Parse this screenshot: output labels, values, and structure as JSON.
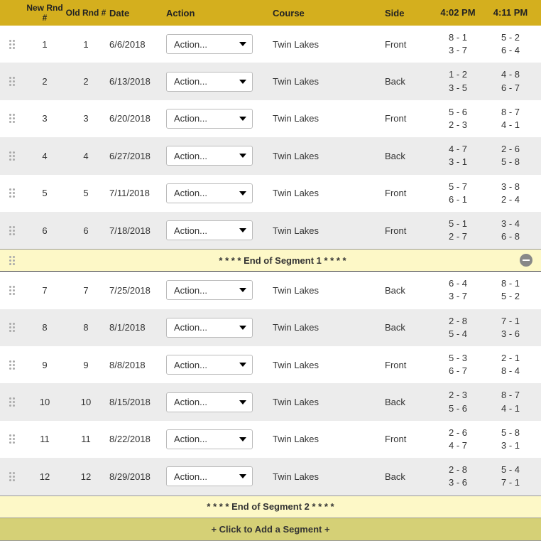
{
  "headers": {
    "new_rnd": "New Rnd #",
    "old_rnd": "Old Rnd #",
    "date": "Date",
    "action": "Action",
    "course": "Course",
    "side": "Side",
    "time1": "4:02 PM",
    "time2": "4:11 PM"
  },
  "action_placeholder": "Action...",
  "segment1": {
    "label": "* * * * End of Segment 1 * * * *",
    "rows": [
      {
        "new": "1",
        "old": "1",
        "date": "6/6/2018",
        "course": "Twin Lakes",
        "side": "Front",
        "t1a": "8 - 1",
        "t1b": "3 - 7",
        "t2a": "5 - 2",
        "t2b": "6 - 4"
      },
      {
        "new": "2",
        "old": "2",
        "date": "6/13/2018",
        "course": "Twin Lakes",
        "side": "Back",
        "t1a": "1 - 2",
        "t1b": "3 - 5",
        "t2a": "4 - 8",
        "t2b": "6 - 7"
      },
      {
        "new": "3",
        "old": "3",
        "date": "6/20/2018",
        "course": "Twin Lakes",
        "side": "Front",
        "t1a": "5 - 6",
        "t1b": "2 - 3",
        "t2a": "8 - 7",
        "t2b": "4 - 1"
      },
      {
        "new": "4",
        "old": "4",
        "date": "6/27/2018",
        "course": "Twin Lakes",
        "side": "Back",
        "t1a": "4 - 7",
        "t1b": "3 - 1",
        "t2a": "2 - 6",
        "t2b": "5 - 8"
      },
      {
        "new": "5",
        "old": "5",
        "date": "7/11/2018",
        "course": "Twin Lakes",
        "side": "Front",
        "t1a": "5 - 7",
        "t1b": "6 - 1",
        "t2a": "3 - 8",
        "t2b": "2 - 4"
      },
      {
        "new": "6",
        "old": "6",
        "date": "7/18/2018",
        "course": "Twin Lakes",
        "side": "Front",
        "t1a": "5 - 1",
        "t1b": "2 - 7",
        "t2a": "3 - 4",
        "t2b": "6 - 8"
      }
    ]
  },
  "segment2": {
    "label": "* * * * End of Segment 2 * * * *",
    "rows": [
      {
        "new": "7",
        "old": "7",
        "date": "7/25/2018",
        "course": "Twin Lakes",
        "side": "Back",
        "t1a": "6 - 4",
        "t1b": "3 - 7",
        "t2a": "8 - 1",
        "t2b": "5 - 2"
      },
      {
        "new": "8",
        "old": "8",
        "date": "8/1/2018",
        "course": "Twin Lakes",
        "side": "Back",
        "t1a": "2 - 8",
        "t1b": "5 - 4",
        "t2a": "7 - 1",
        "t2b": "3 - 6"
      },
      {
        "new": "9",
        "old": "9",
        "date": "8/8/2018",
        "course": "Twin Lakes",
        "side": "Front",
        "t1a": "5 - 3",
        "t1b": "6 - 7",
        "t2a": "2 - 1",
        "t2b": "8 - 4"
      },
      {
        "new": "10",
        "old": "10",
        "date": "8/15/2018",
        "course": "Twin Lakes",
        "side": "Back",
        "t1a": "2 - 3",
        "t1b": "5 - 6",
        "t2a": "8 - 7",
        "t2b": "4 - 1"
      },
      {
        "new": "11",
        "old": "11",
        "date": "8/22/2018",
        "course": "Twin Lakes",
        "side": "Front",
        "t1a": "2 - 6",
        "t1b": "4 - 7",
        "t2a": "5 - 8",
        "t2b": "3 - 1"
      },
      {
        "new": "12",
        "old": "12",
        "date": "8/29/2018",
        "course": "Twin Lakes",
        "side": "Back",
        "t1a": "2 - 8",
        "t1b": "3 - 6",
        "t2a": "5 - 4",
        "t2b": "7 - 1"
      }
    ]
  },
  "add_segment_label": "+ Click to Add a Segment +"
}
